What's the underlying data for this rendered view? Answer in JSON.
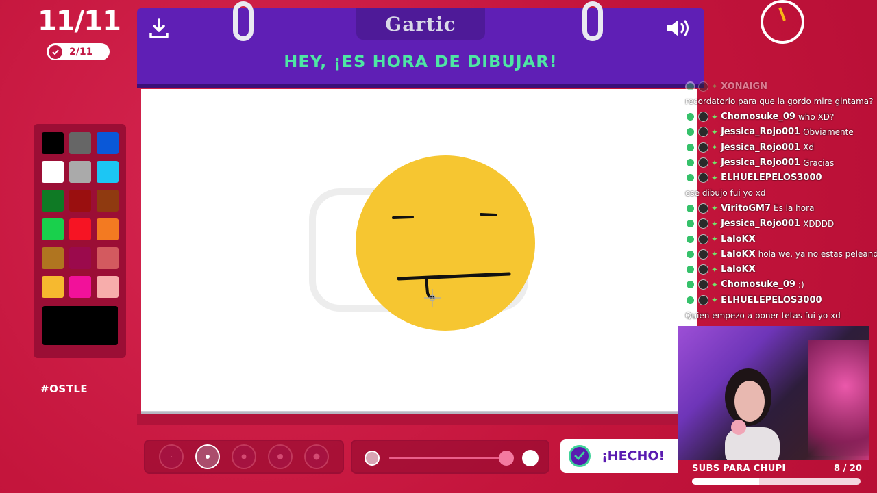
{
  "game": {
    "round_counter": "11/11",
    "players_done": "2/11",
    "brand": "Gartic",
    "title": "HEY, ¡ES HORA DE DIBUJAR!",
    "hashtag": "#OSTLE",
    "done_button_label": "¡HECHO!",
    "icons": {
      "download": "download-icon",
      "sound": "speaker-icon",
      "timer": "timer-icon",
      "check": "check-icon"
    }
  },
  "palette": {
    "colors": [
      "#000000",
      "#666666",
      "#0a58d8",
      "#ffffff",
      "#aaaaaa",
      "#1cc6f4",
      "#0f7a25",
      "#9a0f0f",
      "#8f3a10",
      "#19d04c",
      "#f61423",
      "#f37a21",
      "#b07520",
      "#9b0a4c",
      "#d35a5f",
      "#f6b92f",
      "#f2119a",
      "#f7adab"
    ],
    "current": "#000000"
  },
  "tools": {
    "brush_sizes": [
      "1",
      "2",
      "3",
      "4",
      "5"
    ],
    "selected_brush": 1,
    "opacity_level": 1.0
  },
  "chat": {
    "lines": [
      {
        "user": "XONAIGN",
        "msg": "",
        "faded": true
      },
      {
        "user": "",
        "msg": "recordatorio para que la gordo mire gintama?"
      },
      {
        "user": "Chomosuke_09",
        "msg": "who XD?"
      },
      {
        "user": "Jessica_Rojo001",
        "msg": "Obviamente"
      },
      {
        "user": "Jessica_Rojo001",
        "msg": "Xd"
      },
      {
        "user": "Jessica_Rojo001",
        "msg": "Gracias"
      },
      {
        "user": "ELHUELEPELOS3000",
        "msg": ""
      },
      {
        "user": "",
        "msg": "ese dibujo fui yo xd"
      },
      {
        "user": "ViritoGM7",
        "msg": "Es la hora"
      },
      {
        "user": "Jessica_Rojo001",
        "msg": "XDDDD"
      },
      {
        "user": "LaloKX",
        "msg": ""
      },
      {
        "user": "LaloKX",
        "msg": "hola we, ya no estas peleando?"
      },
      {
        "user": "LaloKX",
        "msg": ""
      },
      {
        "user": "Chomosuke_09",
        "msg": ":)"
      },
      {
        "user": "ELHUELEPELOS3000",
        "msg": ""
      },
      {
        "user": "",
        "msg": "Quien empezo a poner tetas fui yo xd"
      }
    ]
  },
  "stream": {
    "sub_goal_label": "SUBS PARA CHUPI",
    "sub_goal_count": "8 / 20",
    "sub_goal_progress": 0.4
  }
}
